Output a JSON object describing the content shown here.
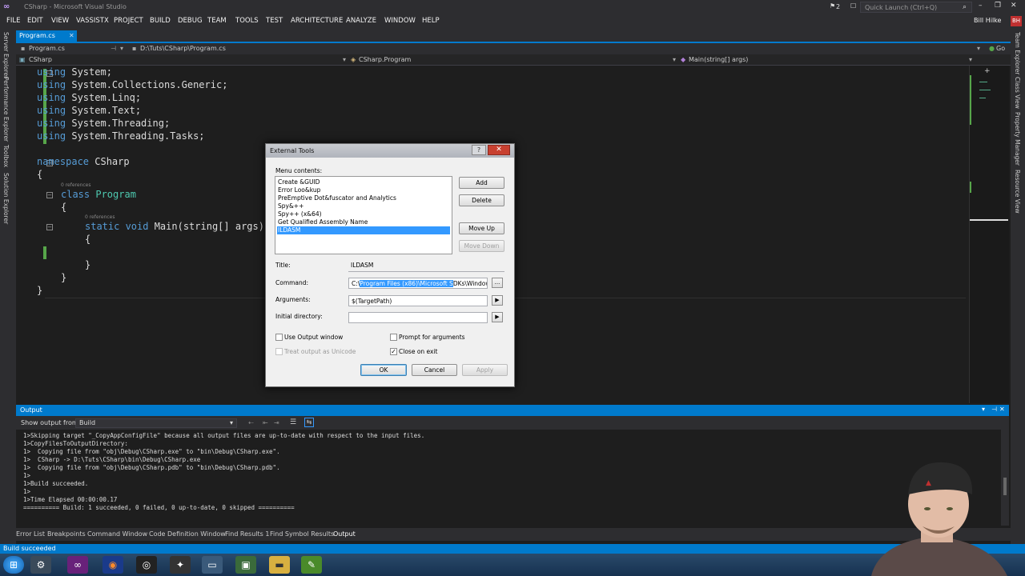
{
  "window": {
    "title": "CSharp - Microsoft Visual Studio",
    "notification_count": "2",
    "quick_launch": "Quick Launch (Ctrl+Q)",
    "user": "Bill Hilke",
    "user_initials": "BH"
  },
  "menu": [
    "FILE",
    "EDIT",
    "VIEW",
    "VASSISTX",
    "PROJECT",
    "BUILD",
    "DEBUG",
    "TEAM",
    "TOOLS",
    "TEST",
    "ARCHITECTURE",
    "ANALYZE",
    "WINDOW",
    "HELP"
  ],
  "left_rail": [
    "Server Explorer",
    "Performance Explorer",
    "Toolbox",
    "Solution Explorer"
  ],
  "right_rail": [
    "Team Explorer",
    "Class View",
    "Property Manager",
    "Resource View"
  ],
  "tabs": {
    "active": "Program.cs",
    "path_file": "Program.cs",
    "path": "D:\\Tuts\\CSharp\\Program.cs",
    "go": "Go"
  },
  "navbar": {
    "project": "CSharp",
    "class": "CSharp.Program",
    "member": "Main(string[] args)"
  },
  "code": {
    "l1_kw": "using",
    "l1_rest": " System;",
    "l2_kw": "using",
    "l2_rest": " System.Collections.Generic;",
    "l3_kw": "using",
    "l3_rest": " System.Linq;",
    "l4_kw": "using",
    "l4_rest": " System.Text;",
    "l5_kw": "using",
    "l5_rest": " System.Threading;",
    "l6_kw": "using",
    "l6_rest": " System.Threading.Tasks;",
    "ns_kw": "namespace",
    "ns_name": " CSharp",
    "brace_open": "{",
    "brace_close": "}",
    "refs": "0 references",
    "class_kw": "class",
    "class_name": " Program",
    "main_kw1": "static",
    "main_kw2": " void",
    "main_name": " Main",
    "main_sig": "(string[] args)"
  },
  "dialog": {
    "title": "External Tools",
    "help": "?",
    "close": "✕",
    "menu_contents_label": "Menu contents:",
    "items": [
      "Create &GUID",
      "Error Loo&kup",
      "PreEmptive Dot&fuscator and Analytics",
      "Spy&++",
      "Spy++ (x&64)",
      "Get Qualified Assembly Name",
      "ILDASM"
    ],
    "selected_index": 6,
    "add": "Add",
    "delete": "Delete",
    "move_up": "Move Up",
    "move_down": "Move Down",
    "title_label": "Title:",
    "title_value": "ILDASM",
    "command_label": "Command:",
    "command_prefix": "C:\\",
    "command_selected": "Program Files (x86)\\Microsoft S",
    "command_suffix": "DKs\\Windows",
    "browse": "...",
    "arguments_label": "Arguments:",
    "arguments_value": "$(TargetPath)",
    "initial_dir_label": "Initial directory:",
    "initial_dir_value": "",
    "arrow": "▶",
    "use_output": "Use Output window",
    "prompt_args": "Prompt for arguments",
    "treat_unicode": "Treat output as Unicode",
    "close_on_exit": "Close on exit",
    "ok": "OK",
    "cancel": "Cancel",
    "apply": "Apply"
  },
  "output": {
    "header": "Output",
    "show_from_label": "Show output from:",
    "show_from_value": "Build",
    "lines": [
      "1>Skipping target \"_CopyAppConfigFile\" because all output files are up-to-date with respect to the input files.",
      "1>CopyFilesToOutputDirectory:",
      "1>  Copying file from \"obj\\Debug\\CSharp.exe\" to \"bin\\Debug\\CSharp.exe\".",
      "1>  CSharp -> D:\\Tuts\\CSharp\\bin\\Debug\\CSharp.exe",
      "1>  Copying file from \"obj\\Debug\\CSharp.pdb\" to \"bin\\Debug\\CSharp.pdb\".",
      "1>",
      "1>Build succeeded.",
      "1>",
      "1>Time Elapsed 00:00:00.17",
      "========== Build: 1 succeeded, 0 failed, 0 up-to-date, 0 skipped =========="
    ]
  },
  "bottom_tabs": [
    "Error List",
    "Breakpoints",
    "Command Window",
    "Code Definition Window",
    "Find Results 1",
    "Find Symbol Results",
    "Output"
  ],
  "status": "Build succeeded",
  "colors": {
    "accent": "#007acc",
    "keyword": "#569cd6",
    "type": "#4ec9b0",
    "selection": "#3399ff"
  }
}
